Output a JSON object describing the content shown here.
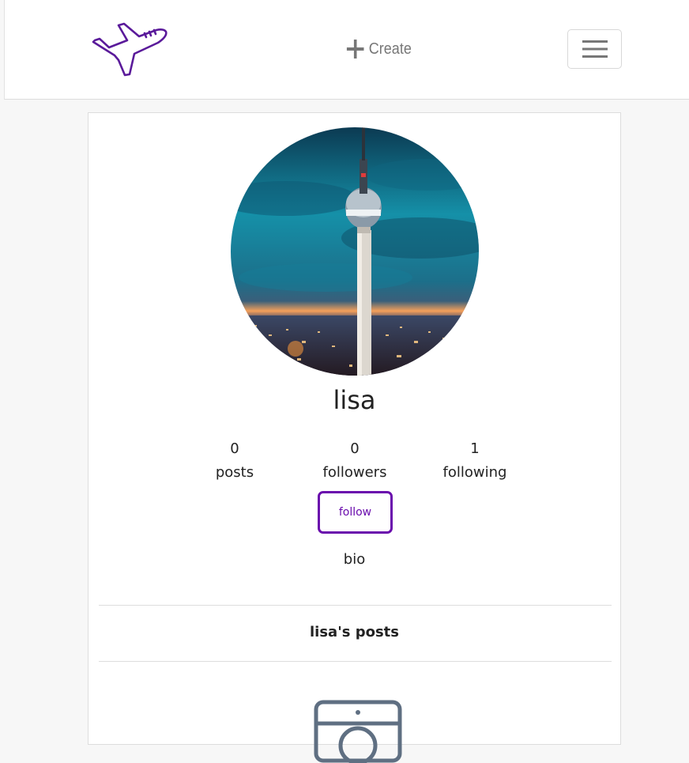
{
  "navbar": {
    "logo_icon": "airplane-icon",
    "create_icon": "plus-icon",
    "create_label": "Create",
    "menu_icon": "hamburger-icon"
  },
  "profile": {
    "avatar_icon": "tv-tower-photo",
    "username": "lisa",
    "stats": [
      {
        "value": "0",
        "label": "posts"
      },
      {
        "value": "0",
        "label": "followers"
      },
      {
        "value": "1",
        "label": "following"
      }
    ],
    "follow_label": "follow",
    "bio": "bio"
  },
  "posts": {
    "heading": "lisa's posts",
    "empty_icon": "camera-icon"
  },
  "colors": {
    "accent": "#6a0dad",
    "muted": "#777777",
    "background": "#f7f7f7"
  }
}
